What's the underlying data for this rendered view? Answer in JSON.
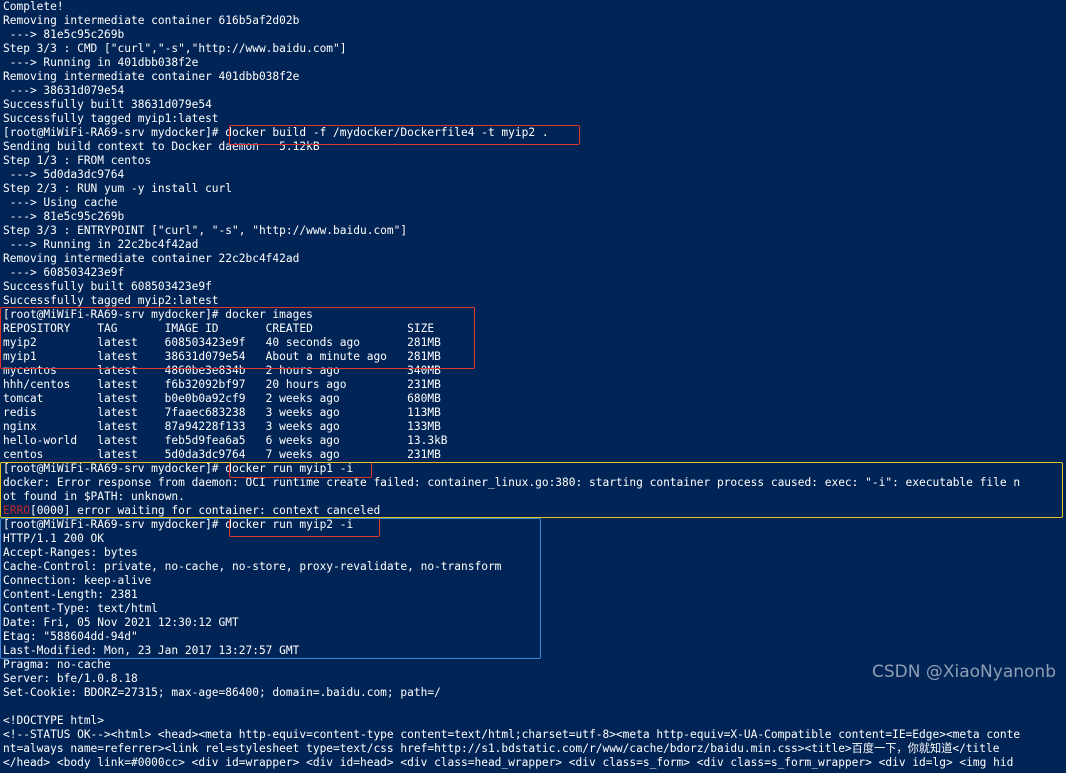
{
  "terminal": {
    "lines": [
      "Complete!",
      "Removing intermediate container 616b5af2d02b",
      " ---> 81e5c95c269b",
      "Step 3/3 : CMD [\"curl\",\"-s\",\"http://www.baidu.com\"]",
      " ---> Running in 401dbb038f2e",
      "Removing intermediate container 401dbb038f2e",
      " ---> 38631d079e54",
      "Successfully built 38631d079e54",
      "Successfully tagged myip1:latest",
      "[root@MiWiFi-RA69-srv mydocker]# docker build -f /mydocker/Dockerfile4 -t myip2 .",
      "Sending build context to Docker daemon   5.12kB",
      "Step 1/3 : FROM centos",
      " ---> 5d0da3dc9764",
      "Step 2/3 : RUN yum -y install curl",
      " ---> Using cache",
      " ---> 81e5c95c269b",
      "Step 3/3 : ENTRYPOINT [\"curl\", \"-s\", \"http://www.baidu.com\"]",
      " ---> Running in 22c2bc4f42ad",
      "Removing intermediate container 22c2bc4f42ad",
      " ---> 608503423e9f",
      "Successfully built 608503423e9f",
      "Successfully tagged myip2:latest",
      "[root@MiWiFi-RA69-srv mydocker]# docker images",
      "REPOSITORY    TAG       IMAGE ID       CREATED              SIZE",
      "myip2         latest    608503423e9f   40 seconds ago       281MB",
      "myip1         latest    38631d079e54   About a minute ago   281MB",
      "mycentos      latest    4860be3e834b   2 hours ago          340MB",
      "hhh/centos    latest    f6b32092bf97   20 hours ago         231MB",
      "tomcat        latest    b0e0b0a92cf9   2 weeks ago          680MB",
      "redis         latest    7faaec683238   3 weeks ago          113MB",
      "nginx         latest    87a94228f133   3 weeks ago          133MB",
      "hello-world   latest    feb5d9fea6a5   6 weeks ago          13.3kB",
      "centos        latest    5d0da3dc9764   7 weeks ago          231MB",
      "[root@MiWiFi-RA69-srv mydocker]# docker run myip1 -i",
      "docker: Error response from daemon: OCI runtime create failed: container_linux.go:380: starting container process caused: exec: \"-i\": executable file n",
      "ot found in $PATH: unknown."
    ],
    "error_line": {
      "prefix": "ERRO",
      "rest": "[0000] error waiting for container: context canceled"
    },
    "lines_after": [
      "[root@MiWiFi-RA69-srv mydocker]# docker run myip2 -i",
      "HTTP/1.1 200 OK",
      "Accept-Ranges: bytes",
      "Cache-Control: private, no-cache, no-store, proxy-revalidate, no-transform",
      "Connection: keep-alive",
      "Content-Length: 2381",
      "Content-Type: text/html",
      "Date: Fri, 05 Nov 2021 12:30:12 GMT",
      "Etag: \"588604dd-94d\"",
      "Last-Modified: Mon, 23 Jan 2017 13:27:57 GMT",
      "Pragma: no-cache",
      "Server: bfe/1.0.8.18",
      "Set-Cookie: BDORZ=27315; max-age=86400; domain=.baidu.com; path=/",
      "",
      "<!DOCTYPE html>",
      "<!--STATUS OK--><html> <head><meta http-equiv=content-type content=text/html;charset=utf-8><meta http-equiv=X-UA-Compatible content=IE=Edge><meta conte",
      "nt=always name=referrer><link rel=stylesheet type=text/css href=http://s1.bdstatic.com/r/www/cache/bdorz/baidu.min.css><title>百度一下，你就知道</title",
      "</head> <body link=#0000cc> <div id=wrapper> <div id=head> <div class=head_wrapper> <div class=s_form> <div class=s_form_wrapper> <div id=lg> <img hid"
    ]
  },
  "watermark": "CSDN @XiaoNyanonb",
  "colors": {
    "background": "#012456",
    "text": "#ffffff",
    "error_prefix": "#c22b2b",
    "highlight_red": "#e0342f",
    "highlight_yellow": "#e8c21e",
    "highlight_blue": "#3f86d8"
  }
}
